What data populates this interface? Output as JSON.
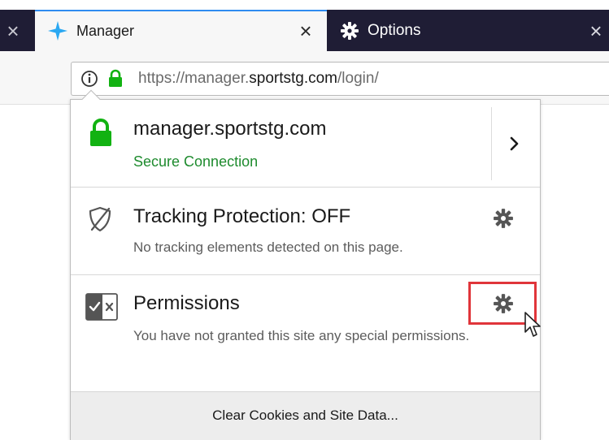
{
  "tabs": [
    {
      "label": "Manager",
      "icon": "star-icon",
      "active": true
    },
    {
      "label": "Options",
      "icon": "gear-icon",
      "active": false
    }
  ],
  "urlbar": {
    "scheme_prefix": "https://manager.",
    "domain": "sportstg.com",
    "path": "/login/"
  },
  "identity_panel": {
    "host": "manager.sportstg.com",
    "connection_status": "Secure Connection",
    "tracking": {
      "title": "Tracking Protection: OFF",
      "description": "No tracking elements detected on this page."
    },
    "permissions": {
      "title": "Permissions",
      "description": "You have not granted this site any special permissions."
    },
    "footer_button": "Clear Cookies and Site Data..."
  },
  "colors": {
    "tab_strip": "#1f1d35",
    "active_tab_accent": "#2f8cf0",
    "secure_green": "#1e8b2e",
    "highlight_red": "#e0353a"
  },
  "glyphs": {
    "close": "×"
  }
}
